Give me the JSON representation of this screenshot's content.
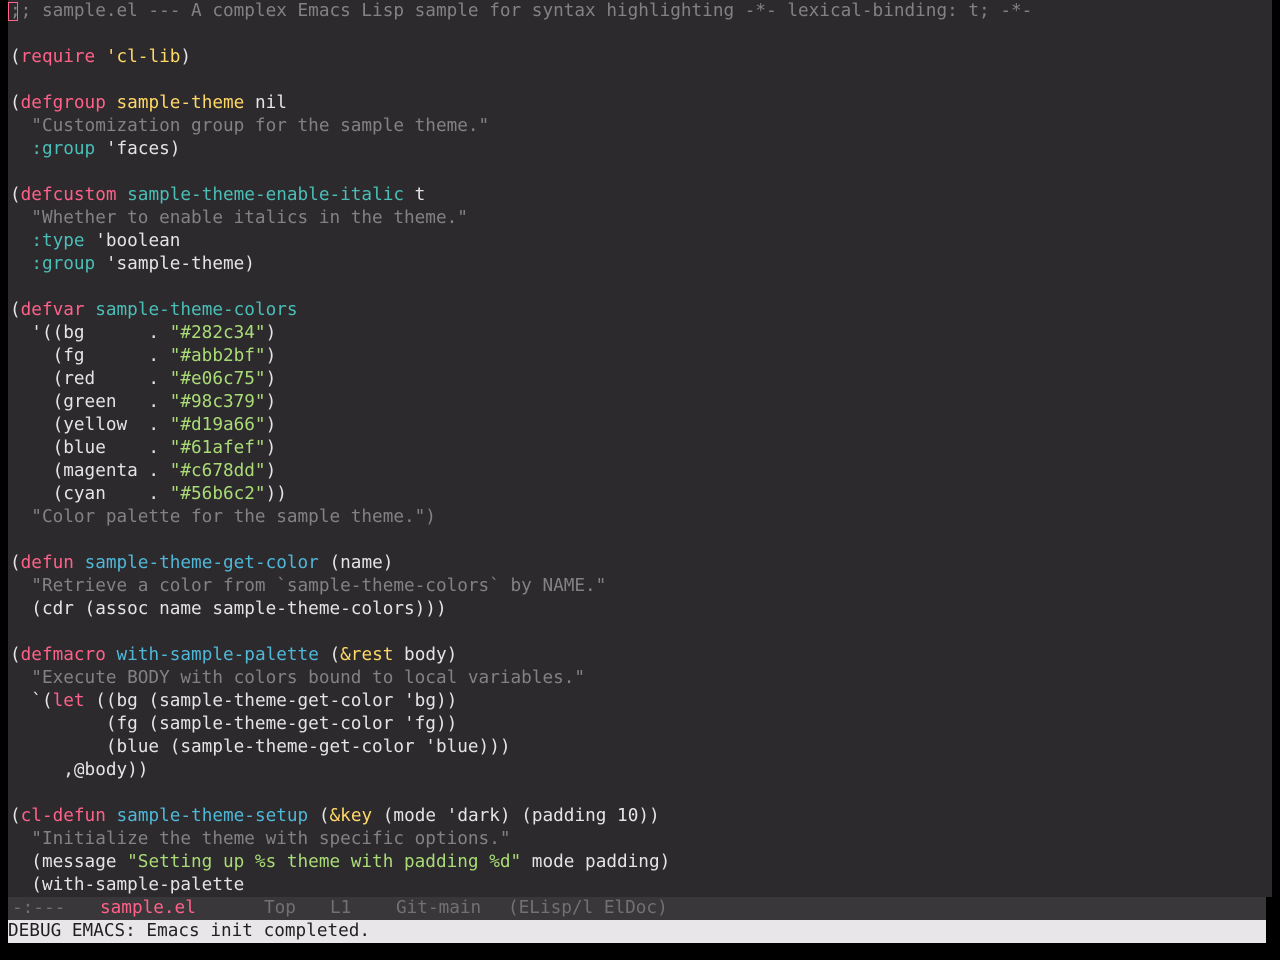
{
  "colors": {
    "background": "#2d2a2e",
    "foreground": "#e6e3e6",
    "comment": "#848185",
    "keyword": "#ff6188",
    "function": "#4fb8d8",
    "variable": "#49bfb7",
    "string": "#a9dc76",
    "constant": "#ffd866",
    "modeline_bg": "#3a373b",
    "echo_bg": "#e9e6e9"
  },
  "buffer": {
    "lines": [
      [
        {
          "t": ";; sample.el --- A complex Emacs Lisp sample for syntax highlighting -*- lexical-binding: t; -*-",
          "c": "comment"
        }
      ],
      [],
      [
        {
          "t": "(",
          "c": "fg"
        },
        {
          "t": "require",
          "c": "keyword"
        },
        {
          "t": " ",
          "c": "fg"
        },
        {
          "t": "'cl-lib",
          "c": "constant"
        },
        {
          "t": ")",
          "c": "fg"
        }
      ],
      [],
      [
        {
          "t": "(",
          "c": "fg"
        },
        {
          "t": "defgroup",
          "c": "keyword"
        },
        {
          "t": " ",
          "c": "fg"
        },
        {
          "t": "sample-theme",
          "c": "constant"
        },
        {
          "t": " nil",
          "c": "fg"
        }
      ],
      [
        {
          "t": "  \"Customization group for the sample theme.\"",
          "c": "comment"
        }
      ],
      [
        {
          "t": "  ",
          "c": "fg"
        },
        {
          "t": ":group",
          "c": "variable"
        },
        {
          "t": " 'faces)",
          "c": "fg"
        }
      ],
      [],
      [
        {
          "t": "(",
          "c": "fg"
        },
        {
          "t": "defcustom",
          "c": "keyword"
        },
        {
          "t": " ",
          "c": "fg"
        },
        {
          "t": "sample-theme-enable-italic",
          "c": "variable"
        },
        {
          "t": " t",
          "c": "fg"
        }
      ],
      [
        {
          "t": "  \"Whether to enable italics in the theme.\"",
          "c": "comment"
        }
      ],
      [
        {
          "t": "  ",
          "c": "fg"
        },
        {
          "t": ":type",
          "c": "variable"
        },
        {
          "t": " 'boolean",
          "c": "fg"
        }
      ],
      [
        {
          "t": "  ",
          "c": "fg"
        },
        {
          "t": ":group",
          "c": "variable"
        },
        {
          "t": " 'sample-theme)",
          "c": "fg"
        }
      ],
      [],
      [
        {
          "t": "(",
          "c": "fg"
        },
        {
          "t": "defvar",
          "c": "keyword"
        },
        {
          "t": " ",
          "c": "fg"
        },
        {
          "t": "sample-theme-colors",
          "c": "variable"
        }
      ],
      [
        {
          "t": "  '((bg      . ",
          "c": "fg"
        },
        {
          "t": "\"#282c34\"",
          "c": "string"
        },
        {
          "t": ")",
          "c": "fg"
        }
      ],
      [
        {
          "t": "    (fg      . ",
          "c": "fg"
        },
        {
          "t": "\"#abb2bf\"",
          "c": "string"
        },
        {
          "t": ")",
          "c": "fg"
        }
      ],
      [
        {
          "t": "    (red     . ",
          "c": "fg"
        },
        {
          "t": "\"#e06c75\"",
          "c": "string"
        },
        {
          "t": ")",
          "c": "fg"
        }
      ],
      [
        {
          "t": "    (green   . ",
          "c": "fg"
        },
        {
          "t": "\"#98c379\"",
          "c": "string"
        },
        {
          "t": ")",
          "c": "fg"
        }
      ],
      [
        {
          "t": "    (yellow  . ",
          "c": "fg"
        },
        {
          "t": "\"#d19a66\"",
          "c": "string"
        },
        {
          "t": ")",
          "c": "fg"
        }
      ],
      [
        {
          "t": "    (blue    . ",
          "c": "fg"
        },
        {
          "t": "\"#61afef\"",
          "c": "string"
        },
        {
          "t": ")",
          "c": "fg"
        }
      ],
      [
        {
          "t": "    (magenta . ",
          "c": "fg"
        },
        {
          "t": "\"#c678dd\"",
          "c": "string"
        },
        {
          "t": ")",
          "c": "fg"
        }
      ],
      [
        {
          "t": "    (cyan    . ",
          "c": "fg"
        },
        {
          "t": "\"#56b6c2\"",
          "c": "string"
        },
        {
          "t": "))",
          "c": "fg"
        }
      ],
      [
        {
          "t": "  \"Color palette for the sample theme.\")",
          "c": "comment"
        }
      ],
      [],
      [
        {
          "t": "(",
          "c": "fg"
        },
        {
          "t": "defun",
          "c": "keyword"
        },
        {
          "t": " ",
          "c": "fg"
        },
        {
          "t": "sample-theme-get-color",
          "c": "function"
        },
        {
          "t": " (name)",
          "c": "fg"
        }
      ],
      [
        {
          "t": "  \"Retrieve a color from `sample-theme-colors` by NAME.\"",
          "c": "comment"
        }
      ],
      [
        {
          "t": "  (cdr (assoc name sample-theme-colors)))",
          "c": "fg"
        }
      ],
      [],
      [
        {
          "t": "(",
          "c": "fg"
        },
        {
          "t": "defmacro",
          "c": "keyword"
        },
        {
          "t": " ",
          "c": "fg"
        },
        {
          "t": "with-sample-palette",
          "c": "function"
        },
        {
          "t": " (",
          "c": "fg"
        },
        {
          "t": "&rest",
          "c": "constant"
        },
        {
          "t": " body)",
          "c": "fg"
        }
      ],
      [
        {
          "t": "  \"Execute BODY with colors bound to local variables.\"",
          "c": "comment"
        }
      ],
      [
        {
          "t": "  `(",
          "c": "fg"
        },
        {
          "t": "let",
          "c": "keyword"
        },
        {
          "t": " ((bg (sample-theme-get-color 'bg))",
          "c": "fg"
        }
      ],
      [
        {
          "t": "         (fg (sample-theme-get-color 'fg))",
          "c": "fg"
        }
      ],
      [
        {
          "t": "         (blue (sample-theme-get-color 'blue)))",
          "c": "fg"
        }
      ],
      [
        {
          "t": "     ,@body))",
          "c": "fg"
        }
      ],
      [],
      [
        {
          "t": "(",
          "c": "fg"
        },
        {
          "t": "cl-defun",
          "c": "keyword"
        },
        {
          "t": " ",
          "c": "fg"
        },
        {
          "t": "sample-theme-setup",
          "c": "function"
        },
        {
          "t": " (",
          "c": "fg"
        },
        {
          "t": "&key",
          "c": "constant"
        },
        {
          "t": " (mode 'dark) (padding 10))",
          "c": "fg"
        }
      ],
      [
        {
          "t": "  \"Initialize the theme with specific options.\"",
          "c": "comment"
        }
      ],
      [
        {
          "t": "  (message ",
          "c": "fg"
        },
        {
          "t": "\"Setting up %s theme with padding %d\"",
          "c": "string"
        },
        {
          "t": " mode padding)",
          "c": "fg"
        }
      ],
      [
        {
          "t": "  (with-sample-palette",
          "c": "fg"
        }
      ]
    ]
  },
  "modeline": {
    "status": "-:---",
    "buffer_name": "sample.el",
    "position": "Top",
    "line": "L1",
    "vc": "Git-main",
    "modes": "(ELisp/l ElDoc)"
  },
  "echo_area": {
    "message": "DEBUG EMACS: Emacs init completed."
  }
}
